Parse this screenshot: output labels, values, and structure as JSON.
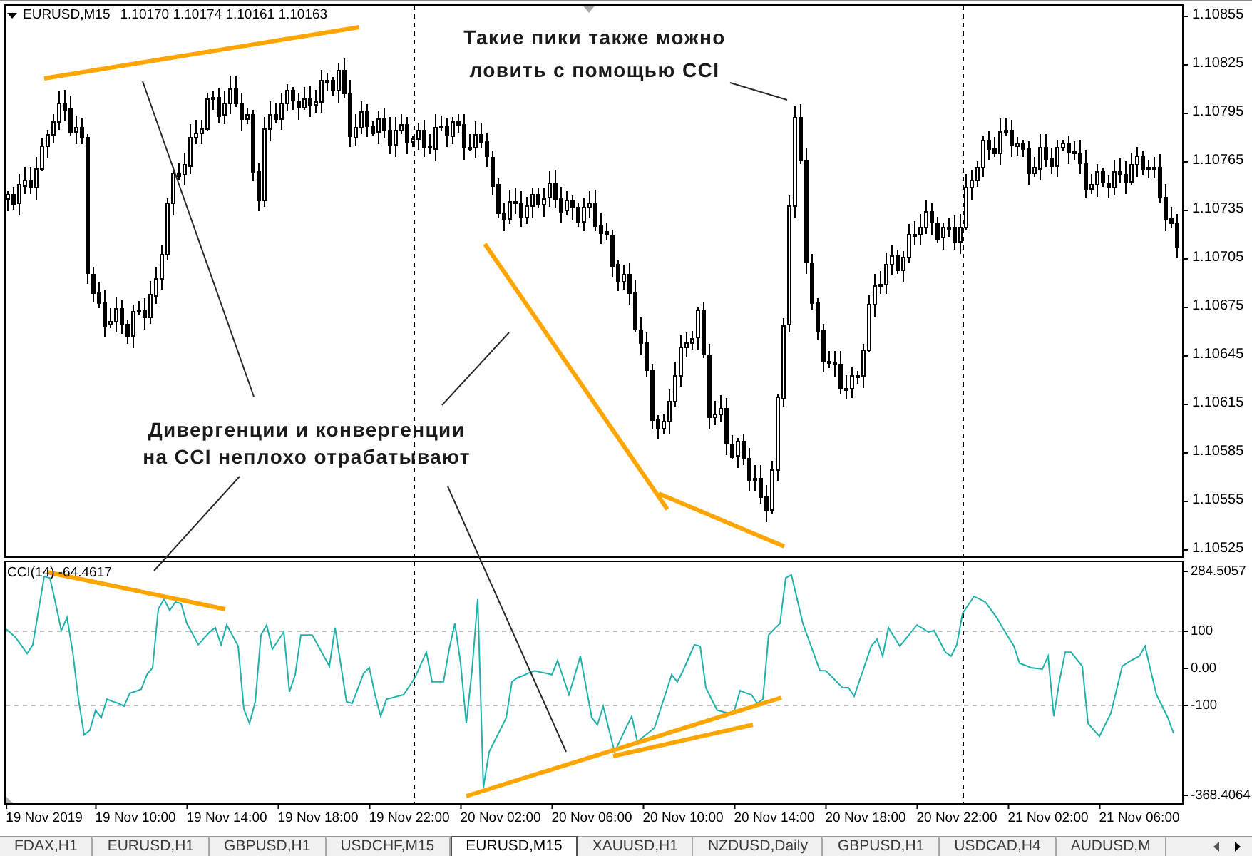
{
  "chart": {
    "symbol": "EURUSD,M15",
    "quotes": "1.10170 1.10174 1.10161 1.10163",
    "price_axis": [
      "1.10855",
      "1.10825",
      "1.10795",
      "1.10765",
      "1.10735",
      "1.10705",
      "1.10675",
      "1.10645",
      "1.10615",
      "1.10585",
      "1.10555",
      "1.10525"
    ],
    "notes": [
      {
        "text": "Такие пики также можно\nловить с помощью CCI"
      },
      {
        "text": "Дивергенции и конвергенции\nна CCI неплохо отрабатывают"
      }
    ]
  },
  "indicator": {
    "label": "CCI(14) -64.4617",
    "scale_max": "284.5057",
    "scale_min": "-368.4064",
    "chart_data": {
      "type": "line",
      "ylim": [
        -368.4064,
        284.5057
      ],
      "yticks": [
        {
          "value": 100,
          "label": "100"
        },
        {
          "value": 0,
          "label": "0.00"
        },
        {
          "value": -100,
          "label": "-100"
        }
      ],
      "categories": [
        null,
        null,
        null,
        null,
        null,
        null,
        null,
        "19 Nov 2019",
        null,
        null,
        null,
        null,
        null,
        null,
        null,
        null,
        null,
        null,
        null,
        null,
        null,
        null,
        null,
        "19 Nov 10:00",
        null,
        null,
        null,
        null,
        null,
        null,
        null,
        null,
        null,
        null,
        null,
        null,
        null,
        null,
        null,
        "19 Nov 14:00",
        null,
        null,
        null,
        null,
        null,
        null,
        null,
        null,
        null,
        null,
        null,
        null,
        null,
        null,
        null,
        "19 Nov 18:00",
        null,
        null,
        null,
        null,
        null,
        null,
        null,
        null,
        null,
        null,
        null,
        null,
        null,
        null,
        null,
        "19 Nov 22:00",
        null,
        null,
        null,
        null,
        null,
        null,
        null,
        null,
        null,
        null,
        null,
        null,
        null,
        null,
        null,
        "20 Nov 02:00",
        null,
        null,
        null,
        null,
        null,
        null,
        null,
        null,
        null,
        null,
        null,
        null,
        null,
        null,
        null,
        "20 Nov 06:00",
        null,
        null,
        null,
        null,
        null,
        null,
        null,
        null,
        null,
        null,
        null,
        null,
        null,
        null,
        null,
        "20 Nov 10:00",
        null,
        null,
        null,
        null,
        null,
        null,
        null,
        null,
        null,
        null,
        null,
        null,
        null,
        null,
        null,
        "20 Nov 14:00",
        null,
        null,
        null,
        null,
        null,
        null,
        null,
        null,
        null,
        null,
        null,
        null,
        null,
        null,
        null,
        "20 Nov 18:00",
        null,
        null,
        null,
        null,
        null,
        null,
        null,
        null,
        null,
        null,
        null,
        null,
        null,
        null,
        null,
        "20 Nov 22:00",
        null,
        null,
        null,
        null,
        null,
        null,
        null,
        null,
        null,
        null,
        null,
        null,
        null,
        null,
        null,
        "21 Nov 02:00",
        null,
        null,
        null,
        null,
        null,
        null,
        null,
        null,
        null,
        null,
        null,
        null,
        null,
        null,
        null,
        "21 Nov 06:00",
        null,
        null,
        null,
        null,
        null,
        null
      ],
      "values": [
        108,
        95,
        81,
        60,
        38,
        62,
        154,
        246,
        242,
        173,
        100,
        135,
        42,
        -85,
        -181,
        -169,
        -115,
        -135,
        -85,
        -91,
        -96,
        -104,
        -69,
        -64,
        -58,
        -19,
        0,
        158,
        185,
        154,
        177,
        173,
        119,
        91,
        62,
        79,
        96,
        108,
        62,
        115,
        87,
        58,
        -112,
        -150,
        -92,
        88,
        115,
        50,
        73,
        96,
        -65,
        -19,
        88,
        88,
        88,
        60,
        32,
        4,
        108,
        8,
        -92,
        -96,
        -56,
        -15,
        0,
        -73,
        -131,
        -85,
        -81,
        -77,
        -73,
        -50,
        -27,
        8,
        42,
        -38,
        -38,
        -38,
        50,
        119,
        12,
        -150,
        -8,
        185,
        -323,
        -227,
        -196,
        -166,
        -135,
        -38,
        -27,
        -21,
        -14,
        -8,
        -12,
        -15,
        -19,
        19,
        -27,
        -73,
        -21,
        31,
        -52,
        -135,
        -154,
        -104,
        -166,
        -227,
        -195,
        -162,
        -131,
        -200,
        -187,
        -175,
        -162,
        -114,
        -67,
        -19,
        -38,
        -8,
        27,
        62,
        58,
        -54,
        -85,
        -115,
        -119,
        -123,
        -115,
        -62,
        -68,
        -73,
        -96,
        -85,
        88,
        104,
        119,
        242,
        250,
        185,
        119,
        77,
        34,
        -8,
        -8,
        -23,
        -39,
        -54,
        -54,
        -77,
        -32,
        13,
        58,
        77,
        31,
        108,
        83,
        58,
        77,
        96,
        115,
        106,
        96,
        100,
        71,
        42,
        31,
        62,
        146,
        169,
        192,
        185,
        177,
        156,
        135,
        108,
        83,
        58,
        12,
        6,
        0,
        -2,
        -4,
        31,
        -131,
        -35,
        42,
        42,
        23,
        4,
        -150,
        -168,
        -185,
        -154,
        -123,
        -60,
        4,
        14,
        23,
        31,
        58,
        -8,
        -73,
        -104,
        -135,
        -177
      ]
    }
  },
  "tabs": [
    {
      "label": "FDAX,H1",
      "selected": false
    },
    {
      "label": "EURUSD,H1",
      "selected": false
    },
    {
      "label": "GBPUSD,H1",
      "selected": false
    },
    {
      "label": "USDCHF,M15",
      "selected": false
    },
    {
      "label": "EURUSD,M15",
      "selected": true
    },
    {
      "label": "XAUUSD,H1",
      "selected": false
    },
    {
      "label": "NZDUSD,Daily",
      "selected": false
    },
    {
      "label": "GBPUSD,H1",
      "selected": false
    },
    {
      "label": "USDCAD,H4",
      "selected": false
    },
    {
      "label": "AUDUSD,M",
      "selected": false
    }
  ]
}
